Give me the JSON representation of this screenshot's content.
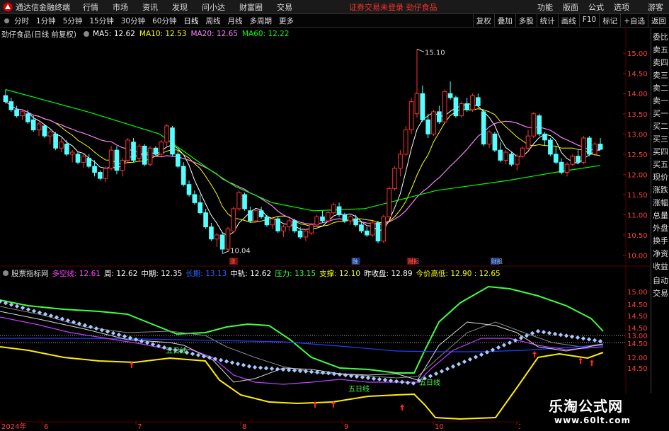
{
  "titlebar": {
    "app_name": "通达信金融终端",
    "menu": [
      "行情",
      "市场",
      "资讯",
      "发现",
      "问小达",
      "财富圈",
      "交易"
    ],
    "warning": "证券交易未登录   劲仔食品",
    "right_menu": [
      "功能",
      "版面",
      "公式",
      "选项"
    ],
    "guest": "游客"
  },
  "periodbar": {
    "periods": [
      "分时",
      "1分钟",
      "5分钟",
      "15分钟",
      "30分钟",
      "60分钟",
      "日线",
      "周线",
      "月线",
      "多周期",
      "更多"
    ],
    "active": "日线",
    "tools": [
      "复权",
      "叠加",
      "多股",
      "统计",
      "画线",
      "F10",
      "标记",
      "+自选",
      "返回"
    ]
  },
  "main_legend": {
    "title": "劲仔食品(日线 前复权)",
    "ma5": "MA5: 12.62",
    "ma10": "MA10: 12.53",
    "ma20": "MA20: 12.65",
    "ma60": "MA60: 12.22"
  },
  "sub_legend": {
    "name": "股票指标网",
    "duokong": "多空线: 12.61",
    "zhou": "周: 12.62",
    "zhongqi": "中期: 12.35",
    "changqi": "长期: 13.13",
    "zhonggui": "中轨: 12.62",
    "yali": "压力: 13.15",
    "zhicheng": "支撑: 12.10",
    "zuoshou": "昨收盘: 12.89",
    "jinjiagaodi": "今价高低: 12.90 : 12.65"
  },
  "right_panel": [
    "委比",
    "卖五",
    "卖四",
    "卖三",
    "卖二",
    "卖一",
    "买一",
    "买二",
    "买三",
    "买四",
    "买五",
    "现价",
    "涨跌",
    "涨幅",
    "总量",
    "外盘",
    "换手",
    "净资",
    "收益",
    "自动",
    "交易"
  ],
  "price_axis": [
    "15.00",
    "14.50",
    "14.00",
    "13.50",
    "13.00",
    "12.50",
    "12.00",
    "11.50",
    "11.00",
    "10.50",
    "10.00"
  ],
  "sub_axis": [
    "15.00",
    "14.50",
    "14.50",
    "14.50",
    "13.00",
    "14.50",
    "12.00",
    "14.50"
  ],
  "annotations": {
    "high": "15.10",
    "low": "10.04",
    "five_day_1": "五日线",
    "five_day_2": "五日线",
    "five_day_3": "五日线",
    "marker_1": "涨",
    "marker_2": "融",
    "marker_3": "财报"
  },
  "xaxis": {
    "labels": [
      "2024年",
      "6",
      "7",
      "8",
      "9",
      "10",
      "11"
    ]
  },
  "watermark": {
    "line1": "乐淘公式网",
    "line2": "www.60lt.com"
  },
  "colors": {
    "up": "#ff3232",
    "down": "#54ffff",
    "ma5": "#ffffff",
    "ma10": "#ffff00",
    "ma20": "#ff80ff",
    "ma60": "#00ff00"
  },
  "chart_data": {
    "type": "candlestick",
    "ylim": [
      9.8,
      15.3
    ],
    "candles": [
      {
        "o": 13.95,
        "h": 14.1,
        "l": 13.75,
        "c": 13.8
      },
      {
        "o": 13.8,
        "h": 13.9,
        "l": 13.55,
        "c": 13.6
      },
      {
        "o": 13.6,
        "h": 13.7,
        "l": 13.4,
        "c": 13.45
      },
      {
        "o": 13.45,
        "h": 13.6,
        "l": 13.35,
        "c": 13.55
      },
      {
        "o": 13.5,
        "h": 13.6,
        "l": 13.25,
        "c": 13.3
      },
      {
        "o": 13.35,
        "h": 13.45,
        "l": 13.05,
        "c": 13.1
      },
      {
        "o": 13.1,
        "h": 13.3,
        "l": 12.95,
        "c": 13.25
      },
      {
        "o": 13.2,
        "h": 13.25,
        "l": 12.9,
        "c": 12.95
      },
      {
        "o": 12.95,
        "h": 13.1,
        "l": 12.75,
        "c": 13.05
      },
      {
        "o": 13.0,
        "h": 13.05,
        "l": 12.6,
        "c": 12.65
      },
      {
        "o": 12.65,
        "h": 12.9,
        "l": 12.55,
        "c": 12.8
      },
      {
        "o": 12.75,
        "h": 12.85,
        "l": 12.45,
        "c": 12.5
      },
      {
        "o": 12.5,
        "h": 12.6,
        "l": 12.3,
        "c": 12.55
      },
      {
        "o": 12.5,
        "h": 12.55,
        "l": 12.25,
        "c": 12.3
      },
      {
        "o": 12.3,
        "h": 12.5,
        "l": 12.15,
        "c": 12.45
      },
      {
        "o": 12.4,
        "h": 12.5,
        "l": 12.15,
        "c": 12.2
      },
      {
        "o": 12.2,
        "h": 12.35,
        "l": 11.95,
        "c": 12.05
      },
      {
        "o": 12.05,
        "h": 12.1,
        "l": 11.85,
        "c": 11.9
      },
      {
        "o": 11.9,
        "h": 12.2,
        "l": 11.8,
        "c": 12.15
      },
      {
        "o": 12.15,
        "h": 12.7,
        "l": 12.1,
        "c": 12.6
      },
      {
        "o": 12.6,
        "h": 12.7,
        "l": 12.0,
        "c": 12.1
      },
      {
        "o": 12.1,
        "h": 12.4,
        "l": 11.95,
        "c": 12.35
      },
      {
        "o": 12.35,
        "h": 12.9,
        "l": 12.3,
        "c": 12.85
      },
      {
        "o": 12.8,
        "h": 12.9,
        "l": 12.3,
        "c": 12.35
      },
      {
        "o": 12.4,
        "h": 12.75,
        "l": 12.3,
        "c": 12.7
      },
      {
        "o": 12.7,
        "h": 12.75,
        "l": 12.2,
        "c": 12.25
      },
      {
        "o": 12.25,
        "h": 12.7,
        "l": 12.2,
        "c": 12.65
      },
      {
        "o": 12.65,
        "h": 12.7,
        "l": 12.45,
        "c": 12.5
      },
      {
        "o": 12.5,
        "h": 12.85,
        "l": 12.45,
        "c": 12.8
      },
      {
        "o": 12.8,
        "h": 13.25,
        "l": 12.7,
        "c": 13.2
      },
      {
        "o": 13.15,
        "h": 13.2,
        "l": 12.45,
        "c": 12.5
      },
      {
        "o": 12.5,
        "h": 12.6,
        "l": 12.15,
        "c": 12.2
      },
      {
        "o": 12.2,
        "h": 12.3,
        "l": 11.7,
        "c": 11.75
      },
      {
        "o": 11.75,
        "h": 11.85,
        "l": 11.45,
        "c": 11.5
      },
      {
        "o": 11.5,
        "h": 11.6,
        "l": 11.25,
        "c": 11.3
      },
      {
        "o": 11.3,
        "h": 11.5,
        "l": 11.0,
        "c": 11.05
      },
      {
        "o": 11.05,
        "h": 11.15,
        "l": 10.65,
        "c": 10.7
      },
      {
        "o": 10.7,
        "h": 10.8,
        "l": 10.35,
        "c": 10.4
      },
      {
        "o": 10.4,
        "h": 10.55,
        "l": 10.2,
        "c": 10.5
      },
      {
        "o": 10.5,
        "h": 10.55,
        "l": 10.04,
        "c": 10.15
      },
      {
        "o": 10.15,
        "h": 10.7,
        "l": 10.1,
        "c": 10.65
      },
      {
        "o": 10.6,
        "h": 11.2,
        "l": 10.55,
        "c": 11.15
      },
      {
        "o": 11.15,
        "h": 11.6,
        "l": 11.1,
        "c": 11.55
      },
      {
        "o": 11.5,
        "h": 11.55,
        "l": 11.1,
        "c": 11.15
      },
      {
        "o": 11.1,
        "h": 11.2,
        "l": 10.8,
        "c": 10.85
      },
      {
        "o": 10.85,
        "h": 11.15,
        "l": 10.8,
        "c": 11.1
      },
      {
        "o": 11.1,
        "h": 11.2,
        "l": 10.9,
        "c": 10.95
      },
      {
        "o": 10.95,
        "h": 11.0,
        "l": 10.7,
        "c": 10.75
      },
      {
        "o": 10.75,
        "h": 10.95,
        "l": 10.65,
        "c": 10.9
      },
      {
        "o": 10.9,
        "h": 10.95,
        "l": 10.55,
        "c": 10.6
      },
      {
        "o": 10.6,
        "h": 10.75,
        "l": 10.45,
        "c": 10.7
      },
      {
        "o": 10.7,
        "h": 10.9,
        "l": 10.6,
        "c": 10.85
      },
      {
        "o": 10.85,
        "h": 10.9,
        "l": 10.55,
        "c": 10.6
      },
      {
        "o": 10.6,
        "h": 10.7,
        "l": 10.4,
        "c": 10.45
      },
      {
        "o": 10.45,
        "h": 10.65,
        "l": 10.35,
        "c": 10.6
      },
      {
        "o": 10.55,
        "h": 10.8,
        "l": 10.5,
        "c": 10.75
      },
      {
        "o": 10.75,
        "h": 11.0,
        "l": 10.7,
        "c": 10.95
      },
      {
        "o": 10.95,
        "h": 11.1,
        "l": 10.8,
        "c": 10.85
      },
      {
        "o": 10.85,
        "h": 11.1,
        "l": 10.8,
        "c": 11.05
      },
      {
        "o": 11.05,
        "h": 11.3,
        "l": 11.0,
        "c": 11.25
      },
      {
        "o": 11.2,
        "h": 11.3,
        "l": 10.95,
        "c": 11.0
      },
      {
        "o": 11.0,
        "h": 11.05,
        "l": 10.8,
        "c": 10.85
      },
      {
        "o": 10.85,
        "h": 11.0,
        "l": 10.75,
        "c": 10.95
      },
      {
        "o": 10.9,
        "h": 11.0,
        "l": 10.7,
        "c": 10.75
      },
      {
        "o": 10.75,
        "h": 10.85,
        "l": 10.55,
        "c": 10.6
      },
      {
        "o": 10.6,
        "h": 10.7,
        "l": 10.45,
        "c": 10.5
      },
      {
        "o": 10.5,
        "h": 10.85,
        "l": 10.45,
        "c": 10.8
      },
      {
        "o": 10.8,
        "h": 10.85,
        "l": 10.3,
        "c": 10.35
      },
      {
        "o": 10.35,
        "h": 11.0,
        "l": 10.3,
        "c": 10.95
      },
      {
        "o": 10.95,
        "h": 11.7,
        "l": 10.9,
        "c": 11.65
      },
      {
        "o": 11.65,
        "h": 12.2,
        "l": 11.6,
        "c": 12.15
      },
      {
        "o": 12.15,
        "h": 12.6,
        "l": 11.95,
        "c": 12.5
      },
      {
        "o": 12.5,
        "h": 13.2,
        "l": 12.45,
        "c": 13.1
      },
      {
        "o": 13.1,
        "h": 13.9,
        "l": 13.0,
        "c": 13.8
      },
      {
        "o": 13.5,
        "h": 15.1,
        "l": 13.4,
        "c": 14.0
      },
      {
        "o": 14.0,
        "h": 14.2,
        "l": 13.3,
        "c": 13.35
      },
      {
        "o": 13.35,
        "h": 13.5,
        "l": 12.9,
        "c": 13.0
      },
      {
        "o": 13.0,
        "h": 13.6,
        "l": 12.95,
        "c": 13.55
      },
      {
        "o": 13.55,
        "h": 13.7,
        "l": 13.25,
        "c": 13.3
      },
      {
        "o": 13.3,
        "h": 14.1,
        "l": 13.25,
        "c": 14.05
      },
      {
        "o": 14.0,
        "h": 14.3,
        "l": 13.85,
        "c": 13.9
      },
      {
        "o": 13.9,
        "h": 13.95,
        "l": 13.4,
        "c": 13.45
      },
      {
        "o": 13.45,
        "h": 13.8,
        "l": 13.4,
        "c": 13.75
      },
      {
        "o": 13.75,
        "h": 13.9,
        "l": 13.55,
        "c": 13.6
      },
      {
        "o": 13.6,
        "h": 14.0,
        "l": 13.55,
        "c": 13.95
      },
      {
        "o": 13.9,
        "h": 14.0,
        "l": 13.65,
        "c": 13.7
      },
      {
        "o": 13.55,
        "h": 13.6,
        "l": 12.7,
        "c": 12.75
      },
      {
        "o": 12.75,
        "h": 13.1,
        "l": 12.65,
        "c": 13.05
      },
      {
        "o": 13.0,
        "h": 13.05,
        "l": 12.55,
        "c": 12.6
      },
      {
        "o": 12.6,
        "h": 12.8,
        "l": 12.3,
        "c": 12.35
      },
      {
        "o": 12.35,
        "h": 12.6,
        "l": 12.25,
        "c": 12.55
      },
      {
        "o": 12.5,
        "h": 12.55,
        "l": 12.2,
        "c": 12.25
      },
      {
        "o": 12.25,
        "h": 12.5,
        "l": 12.1,
        "c": 12.45
      },
      {
        "o": 12.45,
        "h": 12.7,
        "l": 12.4,
        "c": 12.65
      },
      {
        "o": 12.65,
        "h": 13.1,
        "l": 12.6,
        "c": 12.95
      },
      {
        "o": 12.95,
        "h": 13.55,
        "l": 12.9,
        "c": 13.5
      },
      {
        "o": 13.45,
        "h": 13.5,
        "l": 12.95,
        "c": 13.0
      },
      {
        "o": 13.0,
        "h": 13.05,
        "l": 12.7,
        "c": 12.85
      },
      {
        "o": 12.85,
        "h": 12.9,
        "l": 12.45,
        "c": 12.5
      },
      {
        "o": 12.5,
        "h": 12.7,
        "l": 12.25,
        "c": 12.3
      },
      {
        "o": 12.3,
        "h": 12.4,
        "l": 12.0,
        "c": 12.05
      },
      {
        "o": 12.05,
        "h": 12.3,
        "l": 11.95,
        "c": 12.25
      },
      {
        "o": 12.25,
        "h": 12.5,
        "l": 12.2,
        "c": 12.45
      },
      {
        "o": 12.45,
        "h": 12.6,
        "l": 12.25,
        "c": 12.3
      },
      {
        "o": 12.3,
        "h": 12.95,
        "l": 12.25,
        "c": 12.9
      },
      {
        "o": 12.9,
        "h": 12.95,
        "l": 12.45,
        "c": 12.5
      },
      {
        "o": 12.5,
        "h": 12.8,
        "l": 12.45,
        "c": 12.75
      },
      {
        "o": 12.75,
        "h": 12.9,
        "l": 12.65,
        "c": 12.62
      }
    ],
    "ma60": [
      [
        0,
        14.1
      ],
      [
        40,
        13.55
      ],
      [
        75,
        13.0
      ],
      [
        100,
        12.1
      ],
      [
        112,
        11.7
      ],
      [
        130,
        11.3
      ],
      [
        150,
        11.1
      ],
      [
        175,
        11.15
      ],
      [
        210,
        11.6
      ],
      [
        245,
        11.85
      ],
      [
        268,
        12.05
      ],
      [
        290,
        12.22
      ]
    ],
    "sub_axis_ylim": [
      10.9,
      15.6
    ]
  }
}
